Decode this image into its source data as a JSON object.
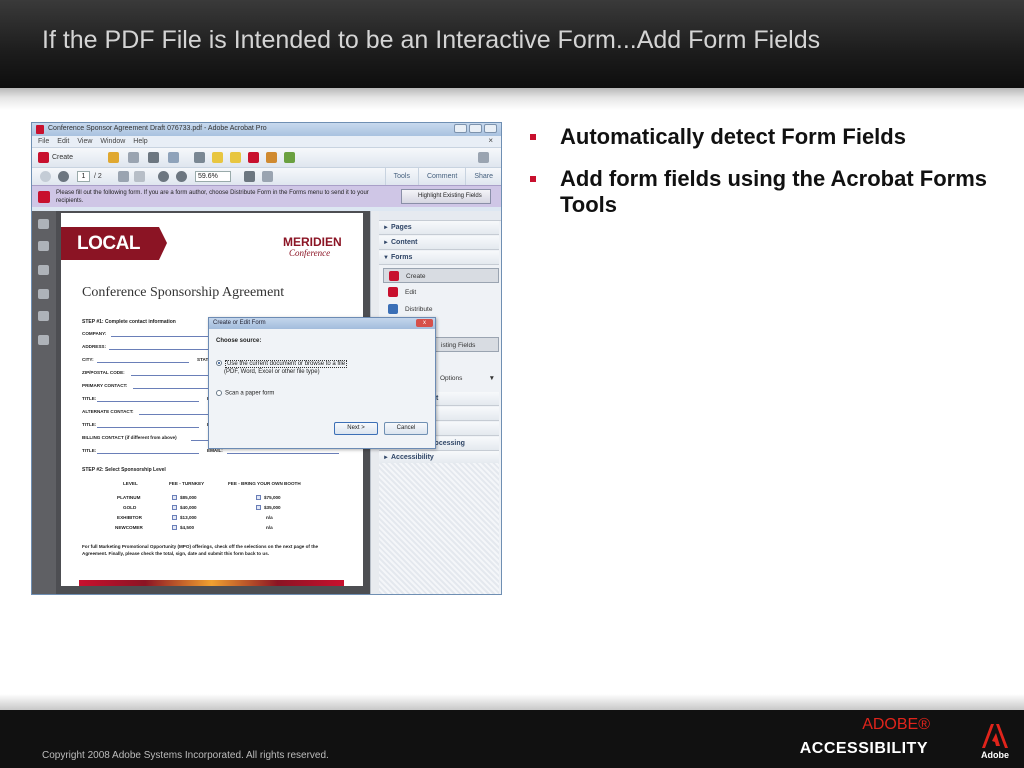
{
  "slide": {
    "title": "If the PDF File is Intended to be an Interactive Form...Add Form Fields",
    "bullets": [
      "Automatically detect Form Fields",
      "Add form fields using the Acrobat Forms Tools"
    ],
    "copyright": "Copyright 2008 Adobe Systems Incorporated.  All rights reserved.",
    "brand_line1": "ADOBE®",
    "brand_line2": "ACCESSIBILITY",
    "logo_word": "Adobe"
  },
  "colors": {
    "accent": "#c8102e",
    "dark_band": "#111111",
    "title_text": "#d4d4d4"
  },
  "acrobat": {
    "window_title": "Conference Sponsor Agreement Draft 076733.pdf - Adobe Acrobat Pro",
    "menu": [
      "File",
      "Edit",
      "View",
      "Window",
      "Help"
    ],
    "create_label": "Create",
    "page_current": "1",
    "page_total": "/ 2",
    "zoom": "59.6%",
    "tabs": [
      "Tools",
      "Comment",
      "Share"
    ],
    "form_message": "Please fill out the following form. If you are a form author, choose Distribute Form in the Forms menu to send it to your recipients.",
    "highlight_button": "Highlight Existing Fields",
    "document": {
      "local": "LOCAL",
      "meridien": "MERIDIEN",
      "conference": "Conference",
      "heading": "Conference Sponsorship Agreement",
      "step1": "STEP #1: Complete contact information",
      "fields": [
        "COMPANY:",
        "ADDRESS:",
        "CITY:",
        "ZIP/POSTAL CODE:",
        "PRIMARY CONTACT:",
        "TITLE:",
        "ALTERNATE CONTACT:",
        "TITLE:",
        "BILLING CONTACT (if different from above)",
        "TITLE:"
      ],
      "state_label": "STAT",
      "email_label": "EMAIL:",
      "e_label": "E",
      "step2": "STEP #2: Select Sponsorship Level",
      "table_headers": [
        "LEVEL",
        "FEE - TURNKEY",
        "FEE - BRING YOUR OWN BOOTH"
      ],
      "table_rows": [
        {
          "level": "PLATINUM",
          "turnkey": "$85,000",
          "byob": "$75,000"
        },
        {
          "level": "GOLD",
          "turnkey": "$40,000",
          "byob": "$35,000"
        },
        {
          "level": "EXHIBITOR",
          "turnkey": "$13,000",
          "byob": "n/a"
        },
        {
          "level": "NEWCOMER",
          "turnkey": "$4,500",
          "byob": "n/a"
        }
      ],
      "note": "For full Marketing Promotional Opportunity (MPO) offerings, check off the selections on the next page of the Agreement. Finally, please check the total, sign, date and submit this form back to us."
    },
    "right_panel": {
      "sections": [
        "Pages",
        "Content",
        "Forms"
      ],
      "forms_items": [
        "Create",
        "Edit",
        "Distribute"
      ],
      "partial_button": "isting Fields",
      "partial_options": "Options",
      "partial_t": "t",
      "lower_sections": [
        "Document Processing",
        "Accessibility"
      ]
    },
    "dialog": {
      "title": "Create or Edit Form",
      "close": "x",
      "heading": "Choose source:",
      "option1": "Use the current document or browse to a file",
      "option1_sub": "(PDF, Word, Excel or other file type)",
      "option2": "Scan a paper form",
      "next": "Next >",
      "cancel": "Cancel"
    }
  }
}
